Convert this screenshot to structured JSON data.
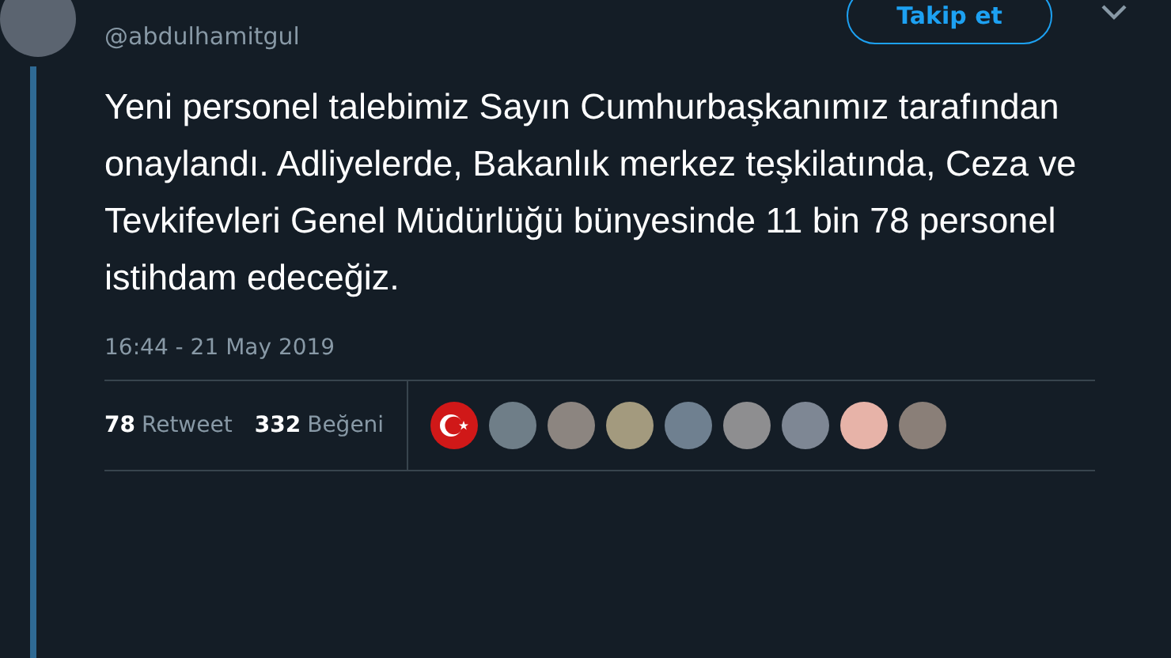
{
  "author": {
    "handle": "@abdulhamitgul"
  },
  "follow_button": "Takip et",
  "tweet_text": "Yeni personel talebimiz Sayın Cumhurbaşkanımız tarafından onaylandı. Adliyelerde, Bakanlık merkez teşkilatında, Ceza ve Tevkifevleri Genel Müdürlüğü bünyesinde 11 bin 78 personel istihdam edeceğiz.",
  "timestamp": "16:44 - 21 May 2019",
  "stats": [
    {
      "count": "78",
      "label": "Retweet"
    },
    {
      "count": "332",
      "label": "Beğeni"
    }
  ],
  "likers": [
    {
      "kind": "flag"
    },
    {
      "kind": "photo"
    },
    {
      "kind": "photo"
    },
    {
      "kind": "photo"
    },
    {
      "kind": "photo"
    },
    {
      "kind": "photo"
    },
    {
      "kind": "photo"
    },
    {
      "kind": "photo"
    },
    {
      "kind": "photo"
    }
  ]
}
